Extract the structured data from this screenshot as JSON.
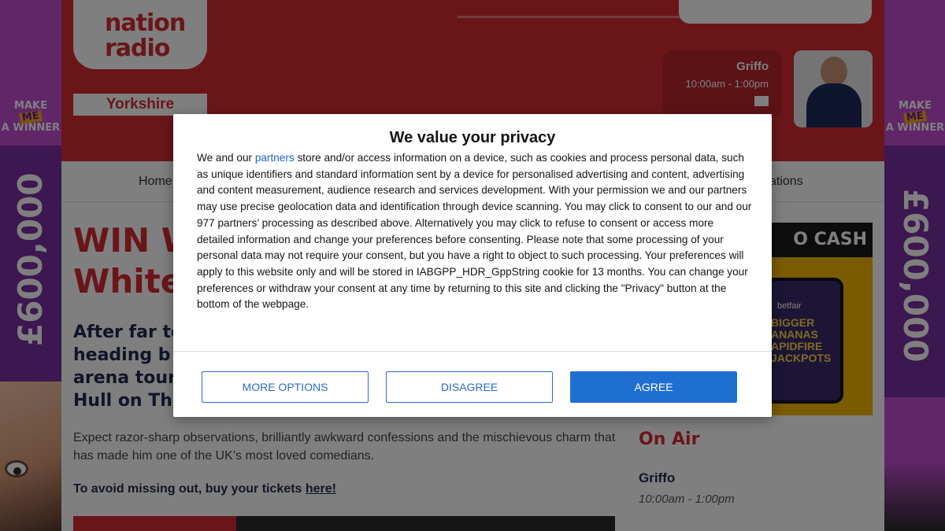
{
  "skin": {
    "badge_line1": "MAKE",
    "badge_me": "ME",
    "badge_line2": "A WINNER",
    "prize": "£600,000"
  },
  "header": {
    "logo_text": "nation radio",
    "region": "Yorkshire",
    "on_air_card": {
      "name": "Griffo",
      "time": "10:00am - 1:00pm"
    }
  },
  "nav": {
    "items": [
      "Home",
      "ations"
    ]
  },
  "article": {
    "headline_line1": "WIN W",
    "headline_line2": "White",
    "subhead_lines": [
      "After far to",
      "heading b",
      "arena tour",
      "Hull on Thu"
    ],
    "body": "Expect razor-sharp observations, brilliantly awkward confessions and the mischievous charm that has made him one of the UK’s most loved comedians.",
    "cta_prefix": "To avoid missing out, buy your tickets ",
    "cta_link": "here!"
  },
  "ad": {
    "label": "O CASH",
    "brand": "betfair",
    "game_lines": [
      "BIGGER",
      "ANANAS",
      "APIDFIRE",
      "JACKPOTS"
    ]
  },
  "sidebar": {
    "on_air_title": "On Air",
    "presenter": "Griffo",
    "time": "10:00am - 1:00pm"
  },
  "consent": {
    "title": "We value your privacy",
    "body_before_link": "We and our ",
    "link_text": "partners",
    "body_after_link": " store and/or access information on a device, such as cookies and process personal data, such as unique identifiers and standard information sent by a device for personalised advertising and content, advertising and content measurement, audience research and services development. With your permission we and our partners may use precise geolocation data and identification through device scanning. You may click to consent to our and our 977 partners’ processing as described above. Alternatively you may click to refuse to consent or access more detailed information and change your preferences before consenting. Please note that some processing of your personal data may not require your consent, but you have a right to object to such processing. Your preferences will apply to this website only and will be stored in IABGPP_HDR_GppString cookie for 13 months. You can change your preferences or withdraw your consent at any time by returning to this site and clicking the \"Privacy\" button at the bottom of the webpage.",
    "buttons": {
      "more_options": "MORE OPTIONS",
      "disagree": "DISAGREE",
      "agree": "AGREE"
    }
  },
  "colors": {
    "brand_red": "#d42d32",
    "navy": "#232b50",
    "skin_purple": "#c24cd0",
    "agree_blue": "#1f6fd1"
  }
}
